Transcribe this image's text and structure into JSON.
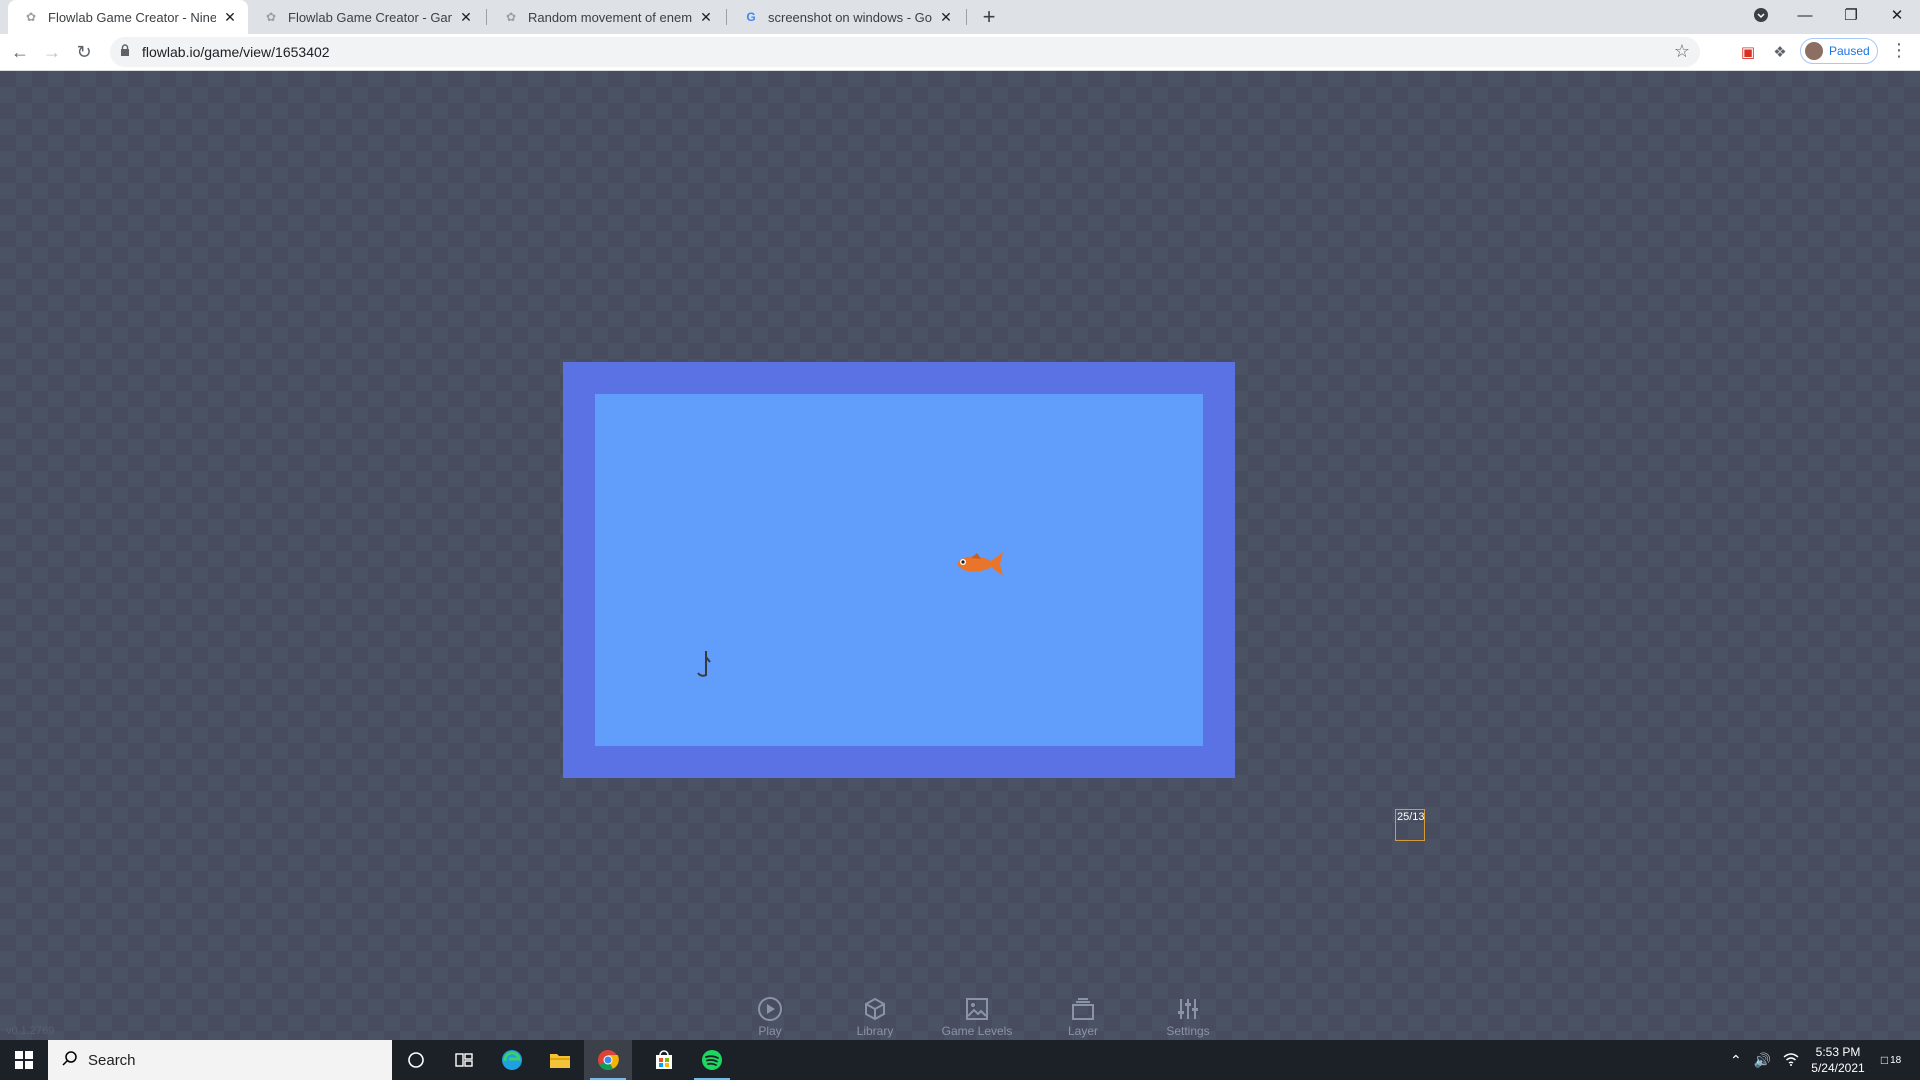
{
  "browser": {
    "tabs": [
      {
        "title": "Flowlab Game Creator - Nine Lives",
        "active": true,
        "favicon": "flowlab-icon"
      },
      {
        "title": "Flowlab Game Creator - Game Over",
        "active": false,
        "favicon": "flowlab-icon"
      },
      {
        "title": "Random movement of enemy sprites",
        "active": false,
        "favicon": "flowlab-icon"
      },
      {
        "title": "screenshot on windows - Google Search",
        "active": false,
        "favicon": "google-icon"
      }
    ],
    "url": "flowlab.io/game/view/1653402",
    "profile_label": "Paused"
  },
  "game": {
    "coord_label": "25/13",
    "version": "v0.1.2769",
    "colors": {
      "frame": "#5a72e3",
      "water": "#619dfa",
      "fish": "#e8752b"
    }
  },
  "gamenav": {
    "items": [
      {
        "label": "Play",
        "icon": "play-icon"
      },
      {
        "label": "Library",
        "icon": "cube-icon"
      },
      {
        "label": "Game Levels",
        "icon": "image-icon"
      },
      {
        "label": "Layer",
        "icon": "layers-icon"
      },
      {
        "label": "Settings",
        "icon": "sliders-icon"
      }
    ]
  },
  "taskbar": {
    "search_placeholder": "Search",
    "time": "5:53 PM",
    "date": "5/24/2021",
    "notification_count": "18"
  }
}
